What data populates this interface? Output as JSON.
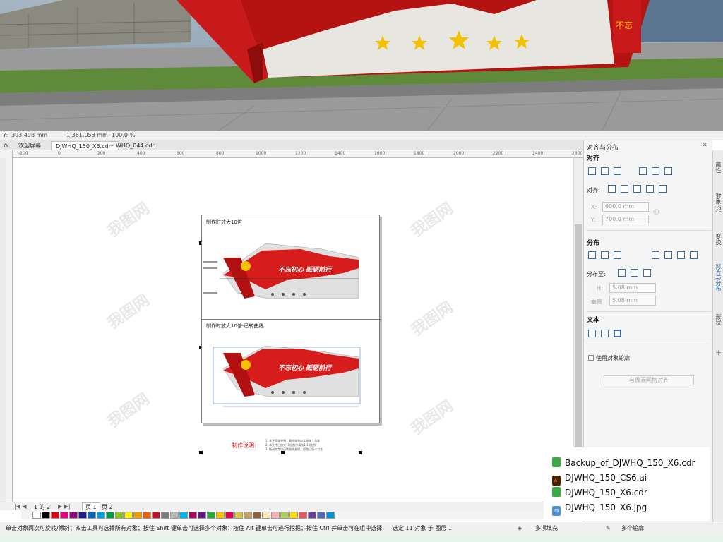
{
  "photo": {
    "sign_text": "不忘初心 牢记使命"
  },
  "propbar": {
    "x_value": "303.498 mm",
    "y_value": "1,381.053 mm",
    "scale": "100.0",
    "unit": "%"
  },
  "tabs": [
    {
      "label": "欢迎屏幕"
    },
    {
      "label": "DJWHQ_150_X6.cdr*"
    },
    {
      "label": "WHQ_044.cdr"
    }
  ],
  "ruler_ticks": [
    "-200",
    "0",
    "200",
    "400",
    "600",
    "800",
    "1000",
    "1200",
    "1400",
    "1600",
    "1800",
    "2000",
    "2200",
    "2400",
    "2600"
  ],
  "document": {
    "section1_title": "制作时放大10倍",
    "section2_title": "制作时放大10倍-已转曲线",
    "notes_label": "制作说明:",
    "notes_lines": [
      "1. 本平面效果图，最终效果以实际施工为准",
      "2. 本文件已放大10倍制作请按1:10比例",
      "3. 所有文字均已转曲线处理，颜色以色卡为准"
    ],
    "banner_text": "不忘初心 砥砺前行"
  },
  "pagebar": {
    "page_of": "1 的 2",
    "page1": "页 1",
    "page2": "页 2"
  },
  "palette": [
    "#ffffff",
    "#000000",
    "#e60012",
    "#e4007f",
    "#920783",
    "#1d2088",
    "#0068b7",
    "#00a0e9",
    "#009944",
    "#8fc31f",
    "#fff100",
    "#f39800",
    "#eb6100",
    "#c30d23",
    "#7d7d7d",
    "#b5b5b6",
    "#00b7ee",
    "#a40b5d",
    "#601986",
    "#22ac38",
    "#fabe00",
    "#e5004f",
    "#d7c447",
    "#c9a063",
    "#8c6239",
    "#ffe4b5",
    "#f5b2b2",
    "#aacf53",
    "#ffdc00",
    "#e95464",
    "#6b3e99",
    "#4c6cb3",
    "#0095d9"
  ],
  "statusbar": {
    "hint": "单击对象两次可旋转/倾斜；双击工具可选择所有对象；按住 Shift 键单击可选择多个对象；按住 Alt 键单击可进行挖掘；按住 Ctrl 并单击可在组中选择",
    "selection": "选定 11 对象 于 图层 1",
    "fill_label": "多项填充",
    "outline_label": "多个轮廓"
  },
  "panel": {
    "title": "对齐与分布",
    "align_heading": "对齐",
    "align_to_label": "对齐:",
    "x_label": "X:",
    "x_value": "600.0 mm",
    "y_label": "Y:",
    "y_value": "700.0 mm",
    "distribute_heading": "分布",
    "distribute_to_label": "分布至:",
    "h_label": "H:",
    "h_value": "5.08 mm",
    "v_label": "垂直:",
    "v_value": "5.08 mm",
    "text_heading": "文本",
    "outline_checkbox": "使用对象轮廓",
    "grid_button": "与像素网格对齐"
  },
  "dock_tabs": [
    "属性",
    "对象(O)",
    "变换",
    "对齐与分布",
    "形状"
  ],
  "files": [
    {
      "name": "Backup_of_DJWHQ_150_X6.cdr",
      "icon": "cdr-icon",
      "color": "#3aa845"
    },
    {
      "name": "DJWHQ_150_CS6.ai",
      "icon": "ai-icon",
      "color": "#4a1e00"
    },
    {
      "name": "DJWHQ_150_X6.cdr",
      "icon": "cdr-icon",
      "color": "#3aa845"
    },
    {
      "name": "DJWHQ_150_X6.jpg",
      "icon": "jpg-icon",
      "color": "#4f8fd6"
    }
  ],
  "watermark": "我图网"
}
